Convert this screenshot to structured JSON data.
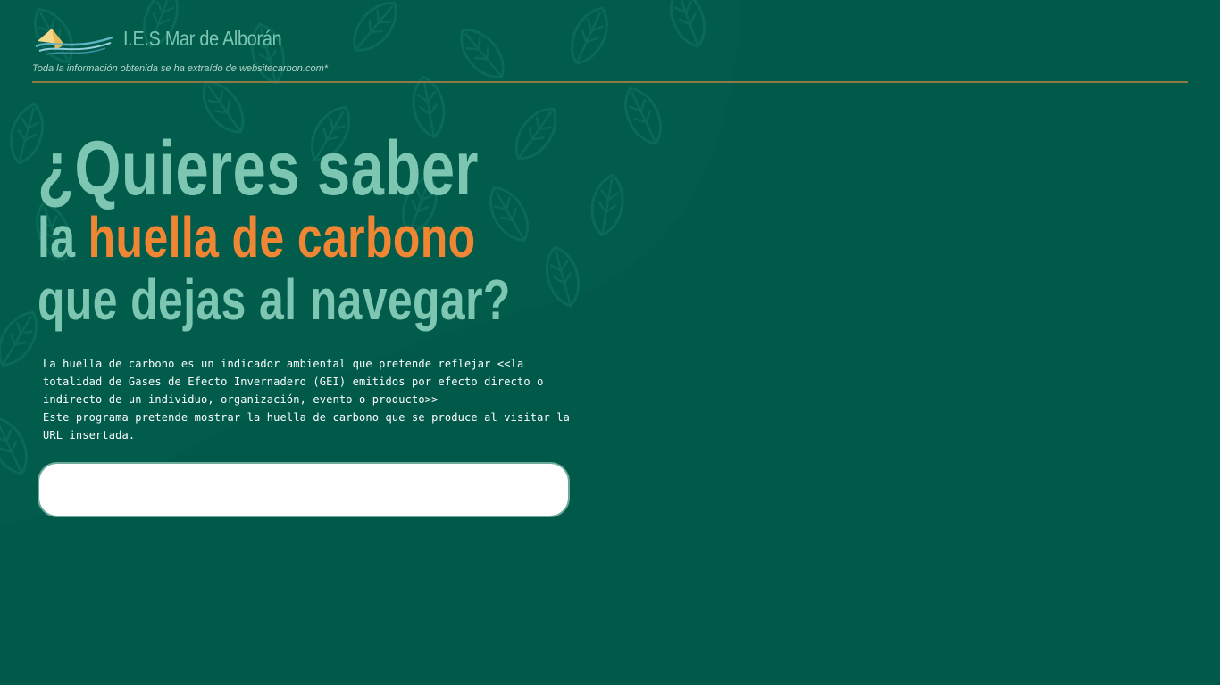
{
  "header": {
    "logo_icon": "sailboat-wave-logo",
    "site_title": "I.E.S Mar de Alborán",
    "disclaimer": "Toda la información obtenida se ha extraído de websitecarbon.com*"
  },
  "hero": {
    "line1": "¿Quieres saber",
    "line2_prefix": "la ",
    "line2_highlight": "huella de carbono",
    "line3": "que dejas al navegar?"
  },
  "description": {
    "line1": "La huella de carbono es un indicador ambiental que pretende reflejar <<la totalidad de Gases de Efecto Invernadero (GEI) emitidos por efecto directo o indirecto de un individuo, organización, evento o producto>>",
    "line2": "Este programa pretende mostrar la huella de carbono que se produce al visitar la URL insertada."
  },
  "url_input": {
    "value": "",
    "placeholder": ""
  },
  "colors": {
    "background": "#01594a",
    "hero_text": "#7cc6b2",
    "accent": "#f08633",
    "divider": "#8e7a45",
    "body_text": "#ffffff"
  }
}
